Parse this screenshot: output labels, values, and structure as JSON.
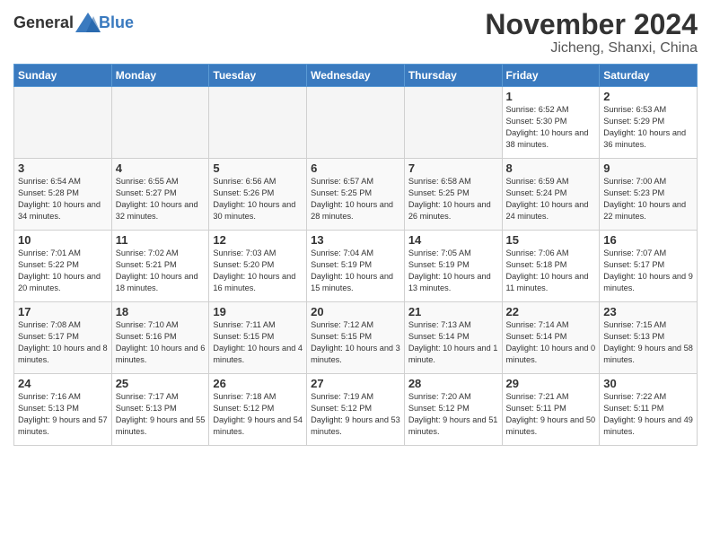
{
  "logo": {
    "general": "General",
    "blue": "Blue"
  },
  "header": {
    "month": "November 2024",
    "location": "Jicheng, Shanxi, China"
  },
  "weekdays": [
    "Sunday",
    "Monday",
    "Tuesday",
    "Wednesday",
    "Thursday",
    "Friday",
    "Saturday"
  ],
  "weeks": [
    [
      {
        "day": "",
        "info": ""
      },
      {
        "day": "",
        "info": ""
      },
      {
        "day": "",
        "info": ""
      },
      {
        "day": "",
        "info": ""
      },
      {
        "day": "",
        "info": ""
      },
      {
        "day": "1",
        "info": "Sunrise: 6:52 AM\nSunset: 5:30 PM\nDaylight: 10 hours and 38 minutes."
      },
      {
        "day": "2",
        "info": "Sunrise: 6:53 AM\nSunset: 5:29 PM\nDaylight: 10 hours and 36 minutes."
      }
    ],
    [
      {
        "day": "3",
        "info": "Sunrise: 6:54 AM\nSunset: 5:28 PM\nDaylight: 10 hours and 34 minutes."
      },
      {
        "day": "4",
        "info": "Sunrise: 6:55 AM\nSunset: 5:27 PM\nDaylight: 10 hours and 32 minutes."
      },
      {
        "day": "5",
        "info": "Sunrise: 6:56 AM\nSunset: 5:26 PM\nDaylight: 10 hours and 30 minutes."
      },
      {
        "day": "6",
        "info": "Sunrise: 6:57 AM\nSunset: 5:25 PM\nDaylight: 10 hours and 28 minutes."
      },
      {
        "day": "7",
        "info": "Sunrise: 6:58 AM\nSunset: 5:25 PM\nDaylight: 10 hours and 26 minutes."
      },
      {
        "day": "8",
        "info": "Sunrise: 6:59 AM\nSunset: 5:24 PM\nDaylight: 10 hours and 24 minutes."
      },
      {
        "day": "9",
        "info": "Sunrise: 7:00 AM\nSunset: 5:23 PM\nDaylight: 10 hours and 22 minutes."
      }
    ],
    [
      {
        "day": "10",
        "info": "Sunrise: 7:01 AM\nSunset: 5:22 PM\nDaylight: 10 hours and 20 minutes."
      },
      {
        "day": "11",
        "info": "Sunrise: 7:02 AM\nSunset: 5:21 PM\nDaylight: 10 hours and 18 minutes."
      },
      {
        "day": "12",
        "info": "Sunrise: 7:03 AM\nSunset: 5:20 PM\nDaylight: 10 hours and 16 minutes."
      },
      {
        "day": "13",
        "info": "Sunrise: 7:04 AM\nSunset: 5:19 PM\nDaylight: 10 hours and 15 minutes."
      },
      {
        "day": "14",
        "info": "Sunrise: 7:05 AM\nSunset: 5:19 PM\nDaylight: 10 hours and 13 minutes."
      },
      {
        "day": "15",
        "info": "Sunrise: 7:06 AM\nSunset: 5:18 PM\nDaylight: 10 hours and 11 minutes."
      },
      {
        "day": "16",
        "info": "Sunrise: 7:07 AM\nSunset: 5:17 PM\nDaylight: 10 hours and 9 minutes."
      }
    ],
    [
      {
        "day": "17",
        "info": "Sunrise: 7:08 AM\nSunset: 5:17 PM\nDaylight: 10 hours and 8 minutes."
      },
      {
        "day": "18",
        "info": "Sunrise: 7:10 AM\nSunset: 5:16 PM\nDaylight: 10 hours and 6 minutes."
      },
      {
        "day": "19",
        "info": "Sunrise: 7:11 AM\nSunset: 5:15 PM\nDaylight: 10 hours and 4 minutes."
      },
      {
        "day": "20",
        "info": "Sunrise: 7:12 AM\nSunset: 5:15 PM\nDaylight: 10 hours and 3 minutes."
      },
      {
        "day": "21",
        "info": "Sunrise: 7:13 AM\nSunset: 5:14 PM\nDaylight: 10 hours and 1 minute."
      },
      {
        "day": "22",
        "info": "Sunrise: 7:14 AM\nSunset: 5:14 PM\nDaylight: 10 hours and 0 minutes."
      },
      {
        "day": "23",
        "info": "Sunrise: 7:15 AM\nSunset: 5:13 PM\nDaylight: 9 hours and 58 minutes."
      }
    ],
    [
      {
        "day": "24",
        "info": "Sunrise: 7:16 AM\nSunset: 5:13 PM\nDaylight: 9 hours and 57 minutes."
      },
      {
        "day": "25",
        "info": "Sunrise: 7:17 AM\nSunset: 5:13 PM\nDaylight: 9 hours and 55 minutes."
      },
      {
        "day": "26",
        "info": "Sunrise: 7:18 AM\nSunset: 5:12 PM\nDaylight: 9 hours and 54 minutes."
      },
      {
        "day": "27",
        "info": "Sunrise: 7:19 AM\nSunset: 5:12 PM\nDaylight: 9 hours and 53 minutes."
      },
      {
        "day": "28",
        "info": "Sunrise: 7:20 AM\nSunset: 5:12 PM\nDaylight: 9 hours and 51 minutes."
      },
      {
        "day": "29",
        "info": "Sunrise: 7:21 AM\nSunset: 5:11 PM\nDaylight: 9 hours and 50 minutes."
      },
      {
        "day": "30",
        "info": "Sunrise: 7:22 AM\nSunset: 5:11 PM\nDaylight: 9 hours and 49 minutes."
      }
    ]
  ]
}
